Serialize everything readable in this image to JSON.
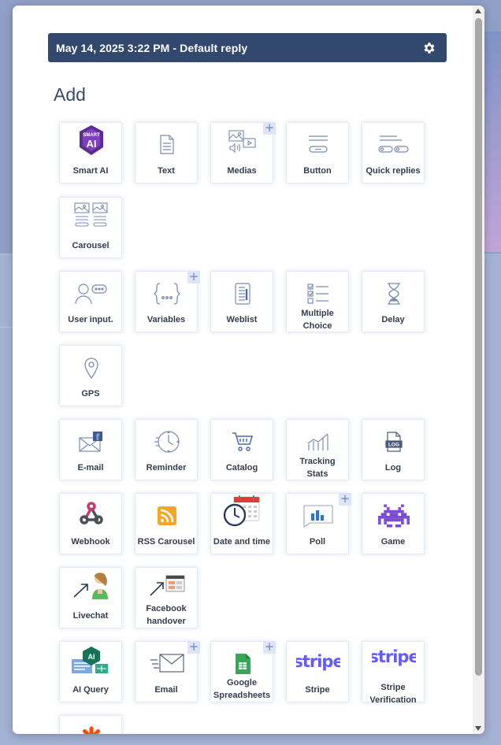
{
  "header": {
    "title": "May 14, 2025 3:22 PM - Default reply"
  },
  "section": {
    "add_title": "Add"
  },
  "items": [
    {
      "key": "smart-ai",
      "label": "Smart AI",
      "plus": false
    },
    {
      "key": "text",
      "label": "Text",
      "plus": false
    },
    {
      "key": "medias",
      "label": "Medias",
      "plus": true
    },
    {
      "key": "button",
      "label": "Button",
      "plus": false
    },
    {
      "key": "quick-replies",
      "label": "Quick replies",
      "plus": false
    },
    {
      "key": "carousel",
      "label": "Carousel",
      "plus": false
    },
    {
      "key": "user-input",
      "label": "User input.",
      "plus": false
    },
    {
      "key": "variables",
      "label": "Variables",
      "plus": true
    },
    {
      "key": "weblist",
      "label": "Weblist",
      "plus": false
    },
    {
      "key": "multiple-choice",
      "label": "Multiple Choice",
      "plus": false
    },
    {
      "key": "delay",
      "label": "Delay",
      "plus": false
    },
    {
      "key": "gps",
      "label": "GPS",
      "plus": false
    },
    {
      "key": "e-mail",
      "label": "E-mail",
      "plus": false
    },
    {
      "key": "reminder",
      "label": "Reminder",
      "plus": false
    },
    {
      "key": "catalog",
      "label": "Catalog",
      "plus": false
    },
    {
      "key": "tracking-stats",
      "label": "Tracking Stats",
      "plus": false
    },
    {
      "key": "log",
      "label": "Log",
      "plus": false
    },
    {
      "key": "webhook",
      "label": "Webhook",
      "plus": false
    },
    {
      "key": "rss-carousel",
      "label": "RSS Carousel",
      "plus": false
    },
    {
      "key": "date-and-time",
      "label": "Date and time",
      "plus": false
    },
    {
      "key": "poll",
      "label": "Poll",
      "plus": true
    },
    {
      "key": "game",
      "label": "Game",
      "plus": false
    },
    {
      "key": "livechat",
      "label": "Livechat",
      "plus": false
    },
    {
      "key": "facebook-handover",
      "label": "Facebook handover",
      "plus": false
    },
    {
      "key": "ai-query",
      "label": "AI Query",
      "plus": false
    },
    {
      "key": "email",
      "label": "Email",
      "plus": true
    },
    {
      "key": "google-spreadsheets",
      "label": "Google Spreadsheets",
      "plus": true
    },
    {
      "key": "stripe",
      "label": "Stripe",
      "plus": false
    },
    {
      "key": "stripe-verification",
      "label": "Stripe Verification",
      "plus": false
    },
    {
      "key": "zapier",
      "label": "",
      "plus": false
    }
  ],
  "icons": {
    "smart_ai_text": "SMART AI",
    "log_text": "LOG",
    "ai_query_text": "AI",
    "stripe_text": "stripe"
  },
  "colors": {
    "header_bg": "#33486e",
    "icon_line": "#7b8cb0",
    "plus_bg": "#dde6f8",
    "stripe": "#635bff",
    "game": "#7b4ad9",
    "rss": "#f5a623",
    "sheets": "#34a853"
  }
}
